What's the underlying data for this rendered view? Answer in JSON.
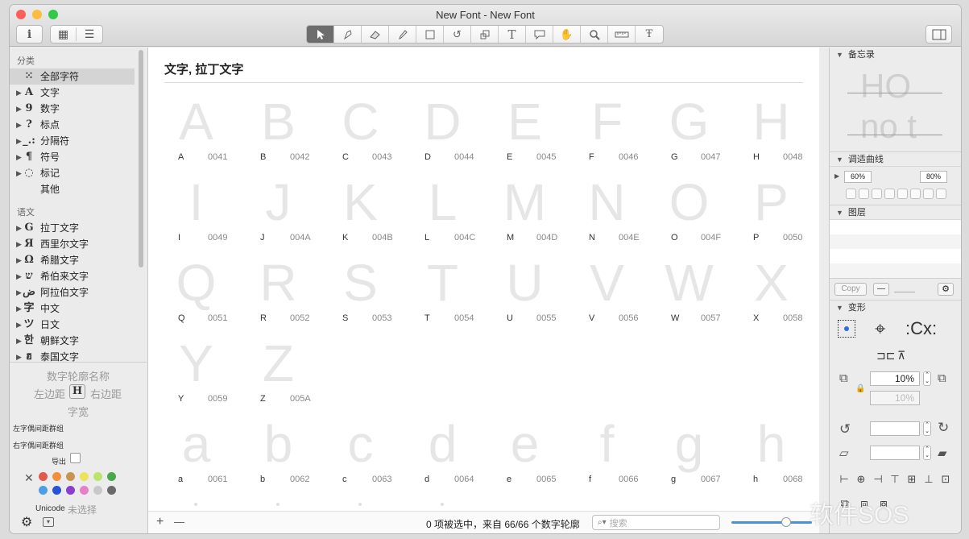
{
  "window": {
    "title": "New Font - New Font"
  },
  "toolbar": {
    "info_glyph": "i",
    "grid_glyph": "▦",
    "list_glyph": "☰",
    "tools": [
      "pointer",
      "pen",
      "eraser",
      "pencil",
      "rectangle",
      "rotate",
      "scale",
      "text",
      "annotation",
      "hand",
      "zoom",
      "measure",
      "glyph-text"
    ]
  },
  "sidebar": {
    "sec_categories": "分类",
    "cat_items": [
      {
        "icon": "⁙",
        "label": "全部字符",
        "tri": ""
      },
      {
        "icon": "A",
        "label": "文字",
        "tri": "▶"
      },
      {
        "icon": "9",
        "label": "数字",
        "tri": "▶"
      },
      {
        "icon": "?",
        "label": "标点",
        "tri": "▶"
      },
      {
        "icon": "_.:",
        "label": "分隔符",
        "tri": "▶"
      },
      {
        "icon": "¶",
        "label": "符号",
        "tri": "▶"
      },
      {
        "icon": "◌",
        "label": "标记",
        "tri": "▶"
      },
      {
        "icon": "",
        "label": "其他",
        "tri": ""
      }
    ],
    "sec_scripts": "语文",
    "script_items": [
      {
        "icon": "G",
        "label": "拉丁文字",
        "tri": "▶"
      },
      {
        "icon": "Я",
        "label": "西里尔文字",
        "tri": "▶"
      },
      {
        "icon": "Ω",
        "label": "希腊文字",
        "tri": "▶"
      },
      {
        "icon": "ש",
        "label": "希伯来文字",
        "tri": "▶"
      },
      {
        "icon": "ض",
        "label": "阿拉伯文字",
        "tri": "▶"
      },
      {
        "icon": "字",
        "label": "中文",
        "tri": "▶"
      },
      {
        "icon": "ツ",
        "label": "日文",
        "tri": "▶"
      },
      {
        "icon": "한",
        "label": "朝鲜文字",
        "tri": "▶"
      },
      {
        "icon": "ฮ",
        "label": "泰国文字",
        "tri": "▶"
      }
    ]
  },
  "glyphinfo": {
    "name_placeholder": "数字轮廓名称",
    "left": "左边距",
    "right": "右边距",
    "width": "字宽",
    "left_kern": "左字偶间距群组",
    "right_kern": "右字偶间距群组",
    "export": "导出",
    "unicode_label": "Unicode",
    "unicode_value": "未选择"
  },
  "colors": {
    "row1": [
      "#e05a4e",
      "#f0903a",
      "#c8954f",
      "#ece35a",
      "#b9e66a",
      "#4aa84a"
    ],
    "row2": [
      "#4c9ee8",
      "#2653d8",
      "#8a3fd0",
      "#e880c8",
      "#c8c8c8",
      "#6a6a6a"
    ]
  },
  "main": {
    "header": "文字, 拉丁文字",
    "glyphs": [
      [
        "A",
        "0041"
      ],
      [
        "B",
        "0042"
      ],
      [
        "C",
        "0043"
      ],
      [
        "D",
        "0044"
      ],
      [
        "E",
        "0045"
      ],
      [
        "F",
        "0046"
      ],
      [
        "G",
        "0047"
      ],
      [
        "H",
        "0048"
      ],
      [
        "I",
        "0049"
      ],
      [
        "J",
        "004A"
      ],
      [
        "K",
        "004B"
      ],
      [
        "L",
        "004C"
      ],
      [
        "M",
        "004D"
      ],
      [
        "N",
        "004E"
      ],
      [
        "O",
        "004F"
      ],
      [
        "P",
        "0050"
      ],
      [
        "Q",
        "0051"
      ],
      [
        "R",
        "0052"
      ],
      [
        "S",
        "0053"
      ],
      [
        "T",
        "0054"
      ],
      [
        "U",
        "0055"
      ],
      [
        "V",
        "0056"
      ],
      [
        "W",
        "0057"
      ],
      [
        "X",
        "0058"
      ],
      [
        "Y",
        "0059"
      ],
      [
        "Z",
        "005A"
      ],
      [
        "",
        ""
      ],
      [
        "",
        ""
      ],
      [
        "",
        ""
      ],
      [
        "",
        ""
      ],
      [
        "",
        ""
      ],
      [
        "",
        ""
      ],
      [
        "a",
        "0061"
      ],
      [
        "b",
        "0062"
      ],
      [
        "c",
        "0063"
      ],
      [
        "d",
        "0064"
      ],
      [
        "e",
        "0065"
      ],
      [
        "f",
        "0066"
      ],
      [
        "g",
        "0067"
      ],
      [
        "h",
        "0068"
      ]
    ],
    "status": "0 项被选中，来自 66/66 个数字轮廓",
    "search_placeholder": "搜索",
    "add": "+",
    "remove": "—"
  },
  "right": {
    "notes": "备忘录",
    "preview_top": "HO",
    "preview_bottom": "no t",
    "curves": "调适曲线",
    "curve_a": "60%",
    "curve_b": "80%",
    "layers": "图层",
    "copy": "Copy",
    "minus": "—",
    "transform": "变形",
    "pct1": "10%",
    "pct2": "10%"
  },
  "watermark": "软件SOS"
}
